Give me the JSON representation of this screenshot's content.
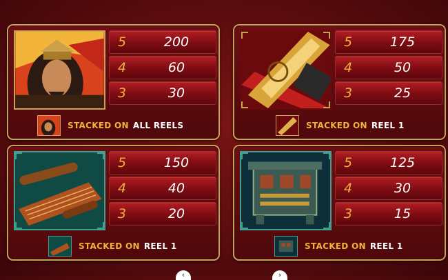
{
  "panels": [
    {
      "symbol_icon": "emperor-portrait-icon",
      "pays": [
        {
          "count": "5",
          "payout": "200"
        },
        {
          "count": "4",
          "payout": "60"
        },
        {
          "count": "3",
          "payout": "30"
        }
      ],
      "stacked_label": "STACKED ON",
      "stacked_value": "ALL REELS"
    },
    {
      "symbol_icon": "golden-dragon-sword-icon",
      "pays": [
        {
          "count": "5",
          "payout": "175"
        },
        {
          "count": "4",
          "payout": "50"
        },
        {
          "count": "3",
          "payout": "25"
        }
      ],
      "stacked_label": "STACKED ON",
      "stacked_value": "REEL 1"
    },
    {
      "symbol_icon": "scroll-and-zither-icon",
      "pays": [
        {
          "count": "5",
          "payout": "150"
        },
        {
          "count": "4",
          "payout": "40"
        },
        {
          "count": "3",
          "payout": "20"
        }
      ],
      "stacked_label": "STACKED ON",
      "stacked_value": "REEL 1"
    },
    {
      "symbol_icon": "bronze-ding-vessel-icon",
      "pays": [
        {
          "count": "5",
          "payout": "125"
        },
        {
          "count": "4",
          "payout": "30"
        },
        {
          "count": "3",
          "payout": "15"
        }
      ],
      "stacked_label": "STACKED ON",
      "stacked_value": "REEL 1"
    }
  ],
  "nav": {
    "prev_icon": "chevron-left-icon",
    "next_icon": "chevron-right-icon",
    "prev": "‹",
    "next": "›"
  },
  "colors": {
    "gold": "#f0b23b",
    "frame": "#c9a25a",
    "row_red": "#b21d23",
    "background": "#5a0c0e"
  }
}
